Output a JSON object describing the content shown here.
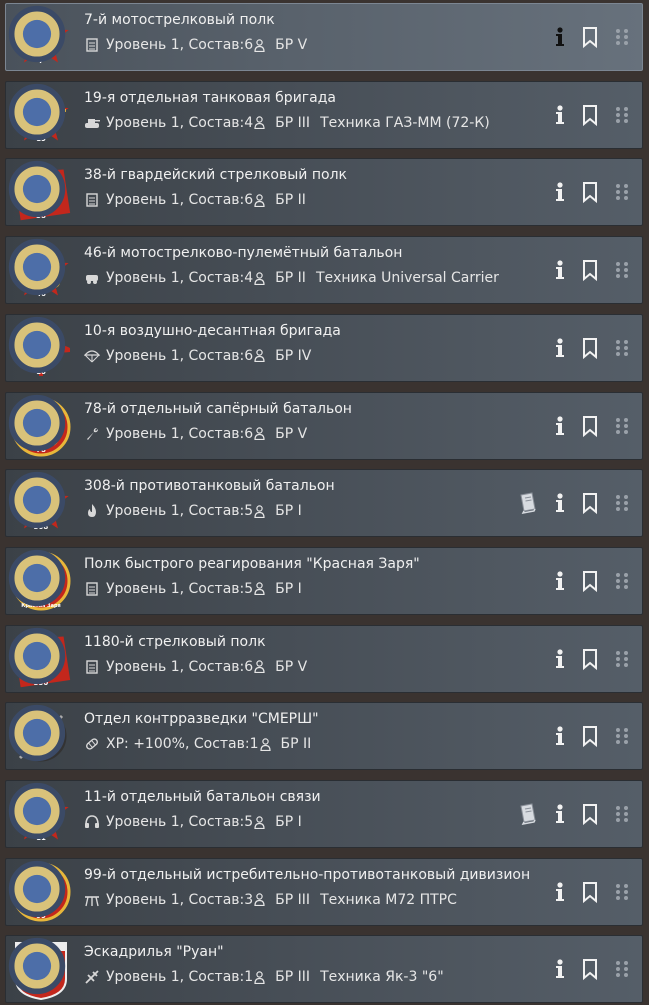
{
  "squads": [
    {
      "name": "7-й мотострелковый полк",
      "kind_icon": "list-icon",
      "level": "Уровень 1, Состав:6",
      "br": "БР V",
      "vehicle": "",
      "badge": "7",
      "emblem": "star-rifle",
      "book": false,
      "selected": true
    },
    {
      "name": "19-я отдельная танковая бригада",
      "kind_icon": "tank-icon",
      "level": "Уровень 1, Состав:4",
      "br": "БР III",
      "vehicle": "Техника ГАЗ-ММ (72-К)",
      "badge": "19",
      "emblem": "star-tank",
      "book": false,
      "selected": false
    },
    {
      "name": "38-й гвардейский стрелковый полк",
      "kind_icon": "list-icon",
      "level": "Уровень 1, Состав:6",
      "br": "БР II",
      "vehicle": "",
      "badge": "38",
      "emblem": "flag-smg",
      "book": false,
      "selected": false
    },
    {
      "name": "46-й мотострелково-пулемётный батальон",
      "kind_icon": "car-icon",
      "level": "Уровень 1, Состав:4",
      "br": "БР II",
      "vehicle": "Техника Universal Carrier",
      "badge": "46",
      "emblem": "star-truck",
      "book": false,
      "selected": false
    },
    {
      "name": "10-я воздушно-десантная бригада",
      "kind_icon": "parachute-icon",
      "level": "Уровень 1, Состав:6",
      "br": "БР IV",
      "vehicle": "",
      "badge": "10",
      "emblem": "wings-star",
      "book": false,
      "selected": false
    },
    {
      "name": "78-й отдельный сапёрный батальон",
      "kind_icon": "wrench-icon",
      "level": "Уровень 1, Состав:6",
      "br": "БР V",
      "vehicle": "",
      "badge": "78",
      "emblem": "circle-axes",
      "book": false,
      "selected": false
    },
    {
      "name": "308-й противотанковый батальон",
      "kind_icon": "fire-icon",
      "level": "Уровень 1, Состав:5",
      "br": "БР I",
      "vehicle": "",
      "badge": "308",
      "emblem": "star-shells",
      "book": true,
      "selected": false
    },
    {
      "name": "Полк быстрого реагирования \"Красная Заря\"",
      "kind_icon": "list-icon",
      "level": "Уровень 1, Состав:5",
      "br": "БР I",
      "vehicle": "",
      "badge": "Красная Заря",
      "emblem": "circle-smg",
      "book": false,
      "selected": false
    },
    {
      "name": "1180-й стрелковый полк",
      "kind_icon": "list-icon",
      "level": "Уровень 1, Состав:6",
      "br": "БР V",
      "vehicle": "",
      "badge": "350",
      "emblem": "flag-smg",
      "book": false,
      "selected": false
    },
    {
      "name": "Отдел контрразведки \"СМЕРШ\"",
      "kind_icon": "ammo-icon",
      "level": "XP: +100%, Состав:1",
      "br": "БР II",
      "vehicle": "",
      "badge": "",
      "emblem": "smersh",
      "book": false,
      "selected": false
    },
    {
      "name": "11-й отдельный батальон связи",
      "kind_icon": "headphones-icon",
      "level": "Уровень 1, Состав:5",
      "br": "БР I",
      "vehicle": "",
      "badge": "11",
      "emblem": "star-headphones",
      "book": true,
      "selected": false
    },
    {
      "name": "99-й отдельный истребительно-противотанковый дивизион",
      "kind_icon": "at-gun-icon",
      "level": "Уровень 1, Состав:3",
      "br": "БР III",
      "vehicle": "Техника M72 ПТРС",
      "badge": "99",
      "emblem": "circle-gun",
      "book": false,
      "selected": false
    },
    {
      "name": "Эскадрилья \"Руан\"",
      "kind_icon": "plane-icon",
      "level": "Уровень 1, Состав:1",
      "br": "БР III",
      "vehicle": "Техника Як-3 \"6\"",
      "badge": "NORMANDIE-NIEMEN",
      "emblem": "normandie",
      "book": false,
      "selected": false
    }
  ],
  "colors": {
    "emblem_red": "#c3271c",
    "emblem_gold": "#e8b73a",
    "selected_border": "#7c8692"
  }
}
